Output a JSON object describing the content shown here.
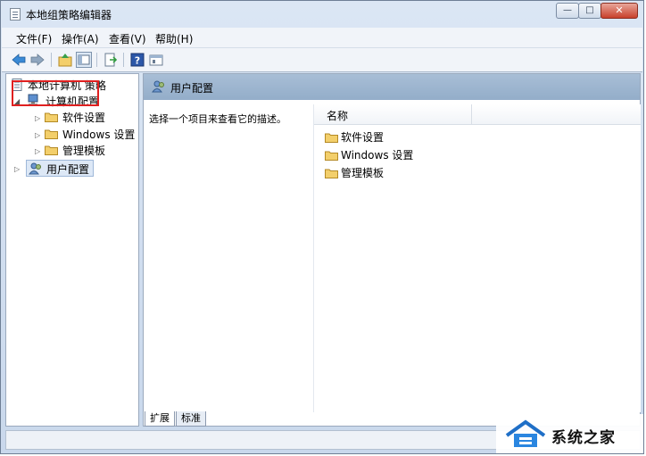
{
  "window": {
    "title": "本地组策略编辑器"
  },
  "menu": [
    "文件(F)",
    "操作(A)",
    "查看(V)",
    "帮助(H)"
  ],
  "tree": {
    "root": "本地计算机 策略",
    "computer_config": "计算机配置",
    "children": [
      "软件设置",
      "Windows 设置",
      "管理模板"
    ],
    "user_config": "用户配置"
  },
  "right": {
    "header": "用户配置",
    "description": "选择一个项目来查看它的描述。",
    "column_name": "名称",
    "items": [
      "软件设置",
      "Windows 设置",
      "管理模板"
    ]
  },
  "tabs": [
    "扩展",
    "标准"
  ],
  "watermark": {
    "text": "系统之家"
  },
  "colors": {
    "highlight_border": "#e02020",
    "panel_header": "#9db4cf",
    "folder": "#f3cf6b"
  }
}
